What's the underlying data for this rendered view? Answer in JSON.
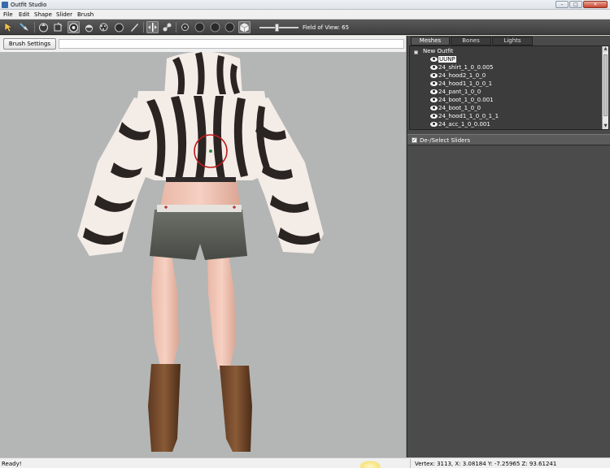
{
  "window": {
    "title": "Outfit Studio",
    "buttons": {
      "minimize": "–",
      "maximize": "□",
      "close": "×"
    }
  },
  "menu": [
    "File",
    "Edit",
    "Shape",
    "Slider",
    "Brush"
  ],
  "toolbar": {
    "tools": [
      "select-tool",
      "transform-tool",
      "inflate-brush",
      "deflate-brush",
      "move-brush",
      "smooth-brush",
      "mask-brush",
      "unmask-brush",
      "weight-brush",
      "color-brush",
      "symmetry-toggle",
      "connected-toggle",
      "brush-size-1",
      "brush-size-2",
      "brush-size-3",
      "brush-size-4",
      "cube-view"
    ],
    "field_of_view_label": "Field of View: 65",
    "field_of_view": 65
  },
  "brush_settings": {
    "label": "Brush Settings >>"
  },
  "panel": {
    "tabs": [
      "Meshes",
      "Bones",
      "Lights"
    ],
    "active_tab": "Meshes",
    "tree": {
      "root": "New Outfit",
      "items": [
        {
          "label": "UUNP",
          "selected": true
        },
        {
          "label": "24_shirt_1_0_0.005",
          "selected": false
        },
        {
          "label": "24_hood2_1_0_0",
          "selected": false
        },
        {
          "label": "24_hood1_1_0_0_1",
          "selected": false
        },
        {
          "label": "24_pant_1_0_0",
          "selected": false
        },
        {
          "label": "24_boot_1_0_0.001",
          "selected": false
        },
        {
          "label": "24_boot_1_0_0",
          "selected": false
        },
        {
          "label": "24_hood1_1_0_0_1_1",
          "selected": false
        },
        {
          "label": "24_acc_1_0_0.001",
          "selected": false
        }
      ]
    },
    "sliders_header": {
      "label": "De-/Select Sliders",
      "checked": true
    }
  },
  "status": {
    "left": "Ready!",
    "right": "Vertex: 3113, X: 3.08184 Y: -7.25965 Z: 93.61241"
  },
  "colors": {
    "viewport_bg": "#b4b6b5",
    "panel_bg": "#4a4a4a",
    "toolbar_bg": "#4a4a4a",
    "brush_ring": "#c01818"
  }
}
